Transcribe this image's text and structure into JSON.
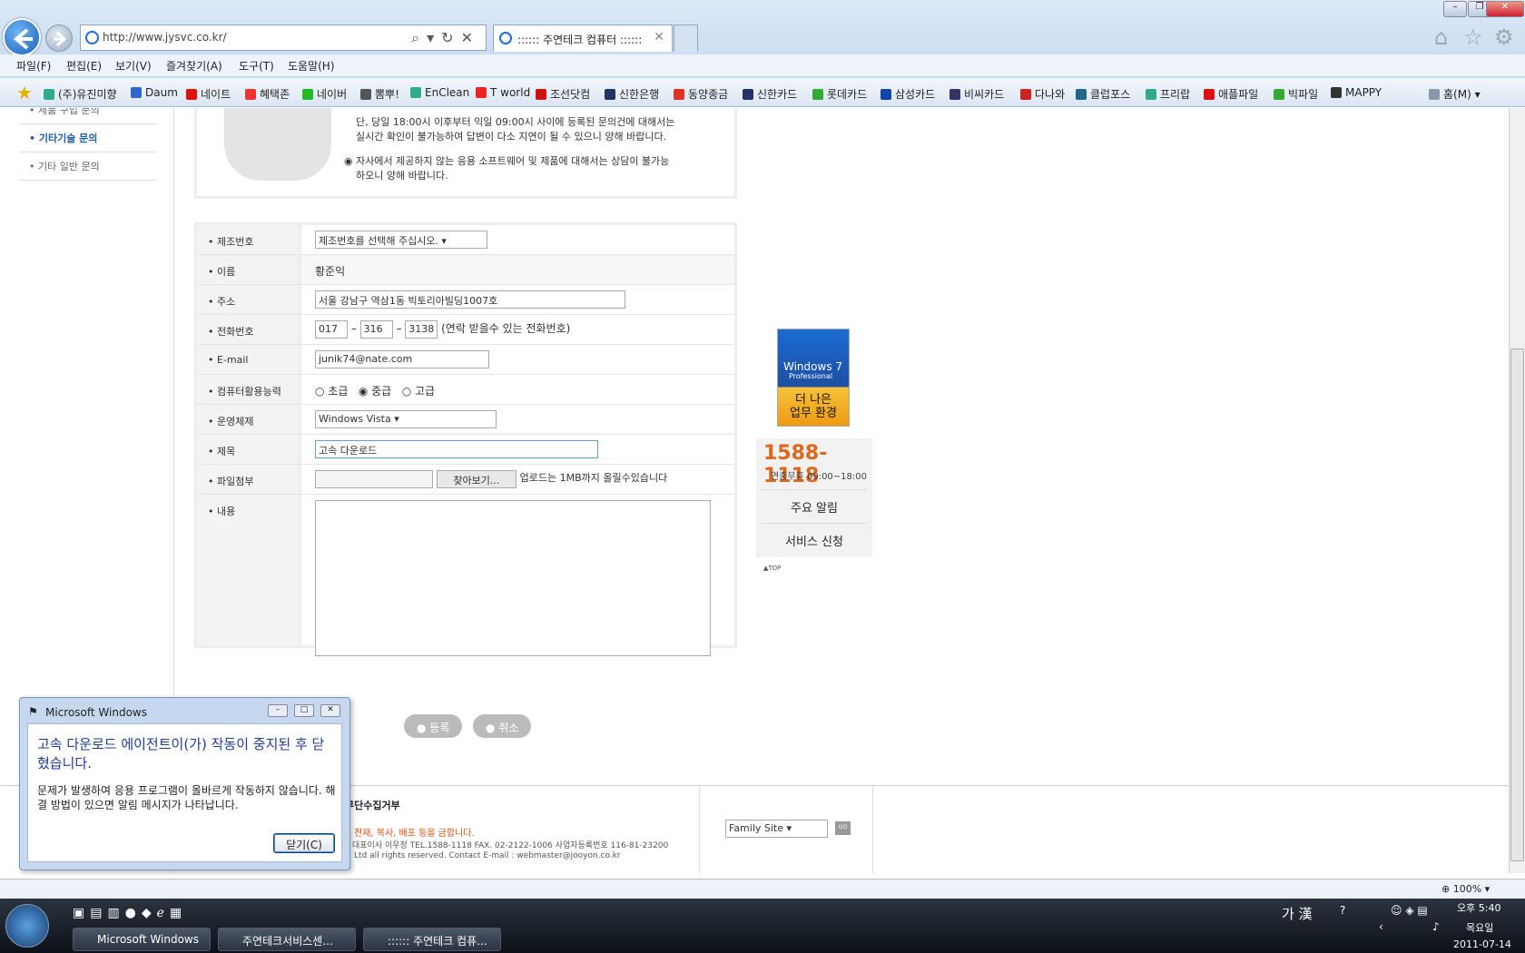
{
  "browser": {
    "url": "http://www.jysvc.co.kr/",
    "tab_title": ":::::: 주연테크 컴퓨터 ::::::",
    "menus": [
      "파일(F)",
      "편집(E)",
      "보기(V)",
      "즐겨찾기(A)",
      "도구(T)",
      "도움말(H)"
    ],
    "favorites": [
      "(주)유진미향",
      "Daum",
      "네이트",
      "혜택존",
      "네이버",
      "뽐뿌!",
      "EnClean",
      "T world",
      "조선닷컴",
      "신한은행",
      "동양종금",
      "신한카드",
      "롯데카드",
      "삼성카드",
      "비씨카드",
      "다나와",
      "클럽포스",
      "프리랍",
      "애플파일",
      "빅파일",
      "MAPPY"
    ],
    "home_label": "홈(M)",
    "zoom": "100%"
  },
  "sidebar": {
    "items": [
      "제품 구입 문의",
      "기타기술 문의",
      "기타 일반 문의"
    ]
  },
  "info": {
    "line1": "단, 당일 18:00시 이후부터 익일 09:00시 사이에 등록된 문의건에 대해서는",
    "line2": "실시간 확인이 불가능하여 답변이 다소 지연이 될 수 있으니 양해 바랍니다.",
    "line3": "자사에서 제공하지 않는 응용 소프트웨어 및 제품에 대해서는 상담이 불가능",
    "line4": "하오니 양해 바랍니다."
  },
  "form": {
    "serial_label": "제조번호",
    "serial_value": "제조번호를 선택해 주십시오.",
    "name_label": "이름",
    "name_value": "황준익",
    "addr_label": "주소",
    "addr_value": "서울 강남구 역삼1동 빅토리아빌딩1007호",
    "phone_label": "전화번호",
    "phone1": "017",
    "phone2": "316",
    "phone3": "3138",
    "phone_note": "(연락 받을수 있는 전화번호)",
    "email_label": "E-mail",
    "email_value": "junik74@nate.com",
    "skill_label": "컴퓨터활용능력",
    "skill_options": [
      "초급",
      "중급",
      "고급"
    ],
    "skill_selected": "중급",
    "os_label": "운영체제",
    "os_value": "Windows Vista",
    "subject_label": "제목",
    "subject_value": "고속 다운로드",
    "file_label": "파일첨부",
    "browse_label": "찾아보기...",
    "file_note": "업로드는 1MB까지 올릴수있습니다",
    "content_label": "내용",
    "submit": "● 등록",
    "cancel": "● 취소"
  },
  "right": {
    "ad_brand": "Windows 7",
    "ad_edition": "Professional",
    "ad_line1": "더 나은",
    "ad_line2": "업무 환경",
    "phone": "1588-1118",
    "hours": "연중무휴 09:00~18:00",
    "notice": "주요 알림",
    "service": "서비스 신청",
    "top": "▲TOP"
  },
  "footer": {
    "refuse": "무단수집거부",
    "copy": "전재, 복사, 배포 등을 금합니다.",
    "company": "대표이사 이우정  TEL.1588-1118   FAX. 02-2122-1006   사업자등록번호 116-81-23200",
    "rights": "Ltd all rights reserved.    Contact E-mail : webmaster@jooyon.co.kr",
    "family": "Family Site",
    "go": "GO"
  },
  "dialog": {
    "title": "Microsoft Windows",
    "heading": "고속 다운로드 에이전트이(가) 작동이 중지된 후 닫혔습니다.",
    "body": "문제가 발생하여 응용 프로그램이 올바르게 작동하지 않습니다. 해결 방법이 있으면 알림 메시지가 나타납니다.",
    "close": "닫기(C)"
  },
  "taskbar": {
    "items": [
      "Microsoft Windows",
      "주연테크서비스센...",
      ":::::: 주연테크 컴퓨..."
    ],
    "ime": "가 漢",
    "time": "오후 5:40",
    "day": "목요일",
    "date": "2011-07-14"
  }
}
